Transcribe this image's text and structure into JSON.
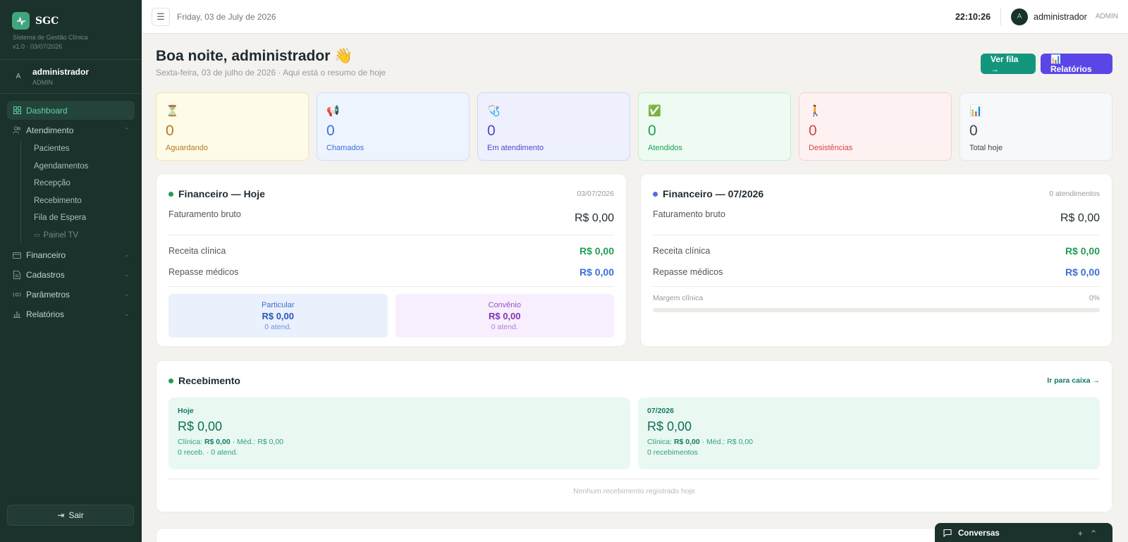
{
  "sidebar": {
    "app_name": "SGC",
    "app_subtitle": "Sistema de Gestão Clínica",
    "version": "v1.0 · 03/07/2026",
    "user": {
      "initial": "A",
      "name": "administrador",
      "role": "ADMIN"
    },
    "nav": {
      "dashboard": "Dashboard",
      "atendimento": "Atendimento",
      "atendimento_items": [
        "Pacientes",
        "Agendamentos",
        "Recepção",
        "Recebimento",
        "Fila de Espera",
        "Painel TV"
      ],
      "financeiro": "Financeiro",
      "cadastros": "Cadastros",
      "parametros": "Parâmetros",
      "relatorios": "Relatórios"
    },
    "logout": "Sair"
  },
  "topbar": {
    "date": "Friday, 03 de July de 2026",
    "time": "22:10:26",
    "user_initial": "A",
    "user_name": "administrador",
    "user_role": "ADMIN"
  },
  "greeting": {
    "title": "Boa noite, administrador 👋",
    "subtitle": "Sexta-feira, 03 de julho de 2026 · Aqui está o resumo de hoje"
  },
  "actions": {
    "queue": "Ver fila →",
    "reports": "📊 Relatórios"
  },
  "stats": [
    {
      "icon": "⏳",
      "value": "0",
      "label": "Aguardando",
      "bg": "#fefbe8",
      "border": "#f5e6a8",
      "color": "#b7791f"
    },
    {
      "icon": "📢",
      "value": "0",
      "label": "Chamados",
      "bg": "#eef4fe",
      "border": "#cddcf8",
      "color": "#3b6fd8"
    },
    {
      "icon": "🩺",
      "value": "0",
      "label": "Em atendimento",
      "bg": "#eef0fd",
      "border": "#cfd4f7",
      "color": "#5046c8"
    },
    {
      "icon": "✅",
      "value": "0",
      "label": "Atendidos",
      "bg": "#edfbf2",
      "border": "#c4ecd3",
      "color": "#1f9d55"
    },
    {
      "icon": "🚶",
      "value": "0",
      "label": "Desistências",
      "bg": "#fef1f1",
      "border": "#f6d0d0",
      "color": "#d64545"
    },
    {
      "icon": "📊",
      "value": "0",
      "label": "Total hoje",
      "bg": "#f7f8fa",
      "border": "#e4e6ea",
      "color": "#3d4650"
    }
  ],
  "fin_today": {
    "title": "Financeiro — Hoje",
    "meta": "03/07/2026",
    "gross_label": "Faturamento bruto",
    "gross_value": "R$ 0,00",
    "clinic_label": "Receita clínica",
    "clinic_value": "R$ 0,00",
    "repasse_label": "Repasse médicos",
    "repasse_value": "R$ 0,00",
    "particular": {
      "title": "Particular",
      "value": "R$ 0,00",
      "count": "0 atend."
    },
    "convenio": {
      "title": "Convênio",
      "value": "R$ 0,00",
      "count": "0 atend."
    }
  },
  "fin_month": {
    "title": "Financeiro — 07/2026",
    "meta": "0 atendimentos",
    "gross_label": "Faturamento bruto",
    "gross_value": "R$ 0,00",
    "clinic_label": "Receita clínica",
    "clinic_value": "R$ 0,00",
    "repasse_label": "Repasse médicos",
    "repasse_value": "R$ 0,00",
    "margin_label": "Margem clínica",
    "margin_value": "0%",
    "margin_fraction": 0
  },
  "recebimento": {
    "title": "Recebimento",
    "link": "Ir para caixa →",
    "today": {
      "title": "Hoje",
      "value": "R$ 0,00",
      "clinic_prefix": "Clínica:",
      "clinic_value": "R$ 0,00",
      "med_prefix": "· Méd.: R$ 0,00",
      "count": "0 receb. · 0 atend."
    },
    "month": {
      "title": "07/2026",
      "value": "R$ 0,00",
      "clinic_prefix": "Clínica:",
      "clinic_value": "R$ 0,00",
      "med_prefix": "· Méd.: R$ 0,00",
      "count": "0 recebimentos"
    },
    "empty": "Nenhum recebimento registrado hoje"
  },
  "chat": {
    "title": "Conversas"
  },
  "colors": {
    "accent": "#14967e",
    "sidebar": "#1b312b",
    "purple": "#5a46e6",
    "green_value": "#1f9d55",
    "blue_value": "#3b6fd8"
  }
}
